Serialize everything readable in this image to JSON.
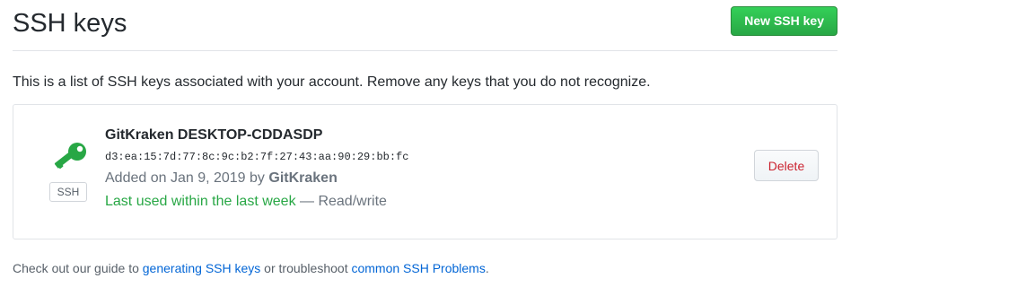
{
  "header": {
    "title": "SSH keys",
    "new_key_label": "New SSH key"
  },
  "intro": {
    "text": "This is a list of SSH keys associated with your account. Remove any keys that you do not recognize."
  },
  "keys": [
    {
      "icon": "key-icon",
      "type_badge": "SSH",
      "title": "GitKraken DESKTOP-CDDASDP",
      "fingerprint": "d3:ea:15:7d:77:8c:9c:b2:7f:27:43:aa:90:29:bb:fc",
      "added_prefix": "Added on Jan 9, 2019 by ",
      "added_by": "GitKraken",
      "usage_recent": "Last used within the last week",
      "usage_access": " — Read/write",
      "delete_label": "Delete"
    }
  ],
  "footer": {
    "prefix": "Check out our guide to ",
    "link1": "generating SSH keys",
    "middle": " or troubleshoot ",
    "link2": "common SSH Problems",
    "suffix": "."
  },
  "colors": {
    "primary_button": "#28a745",
    "key_icon": "#28a745",
    "danger_text": "#cb2431",
    "link": "#0366d6",
    "recent_usage": "#28a745"
  }
}
